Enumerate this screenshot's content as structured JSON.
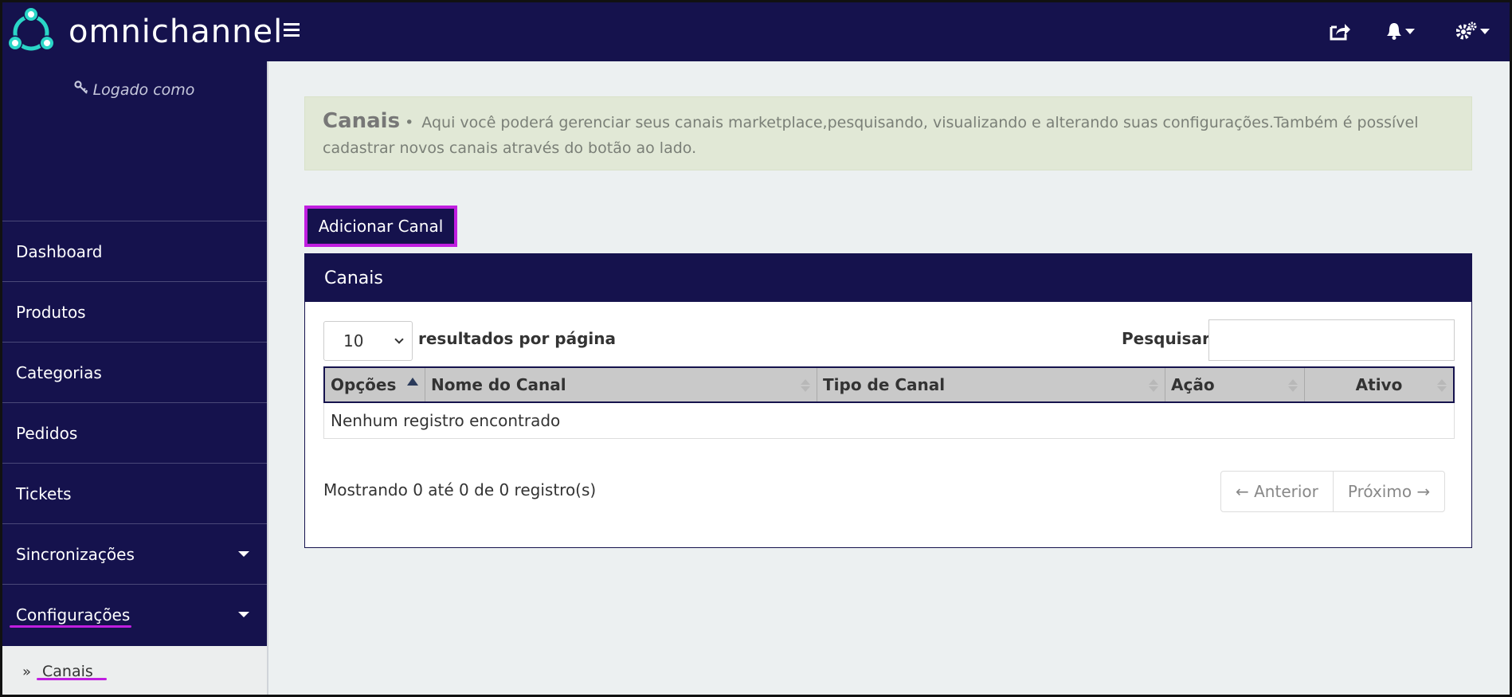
{
  "brand": {
    "name": "omnichannel"
  },
  "topbar": {
    "icons": [
      "share-icon",
      "bell-icon",
      "gears-icon"
    ]
  },
  "sidebar": {
    "logged_label": "Logado como",
    "items": [
      {
        "label": "Dashboard",
        "has_caret": false
      },
      {
        "label": "Produtos",
        "has_caret": false
      },
      {
        "label": "Categorias",
        "has_caret": false
      },
      {
        "label": "Pedidos",
        "has_caret": false
      },
      {
        "label": "Tickets",
        "has_caret": false
      },
      {
        "label": "Sincronizações",
        "has_caret": true
      },
      {
        "label": "Configurações",
        "has_caret": true
      }
    ],
    "submenu": {
      "label": "Canais"
    }
  },
  "alert": {
    "title": "Canais",
    "separator": "•",
    "text": "Aqui você poderá gerenciar seus canais marketplace,pesquisando, visualizando e alterando suas configurações.Também é possível cadastrar novos canais através do botão ao lado."
  },
  "actions": {
    "add_label": "Adicionar Canal"
  },
  "panel": {
    "title": "Canais",
    "length_value": "10",
    "length_label": "resultados por página",
    "search_label": "Pesquisar",
    "search_value": "",
    "columns": [
      "Opções",
      "Nome do Canal",
      "Tipo de Canal",
      "Ação",
      "Ativo"
    ],
    "empty_text": "Nenhum registro encontrado",
    "info": "Mostrando 0 até 0 de 0 registro(s)",
    "prev_label": "← Anterior",
    "next_label": "Próximo →"
  },
  "colors": {
    "navy": "#15124d",
    "highlight": "#c01ee0",
    "logo_teal": "#2ad6c7",
    "alert_bg": "#e1e8d6"
  }
}
